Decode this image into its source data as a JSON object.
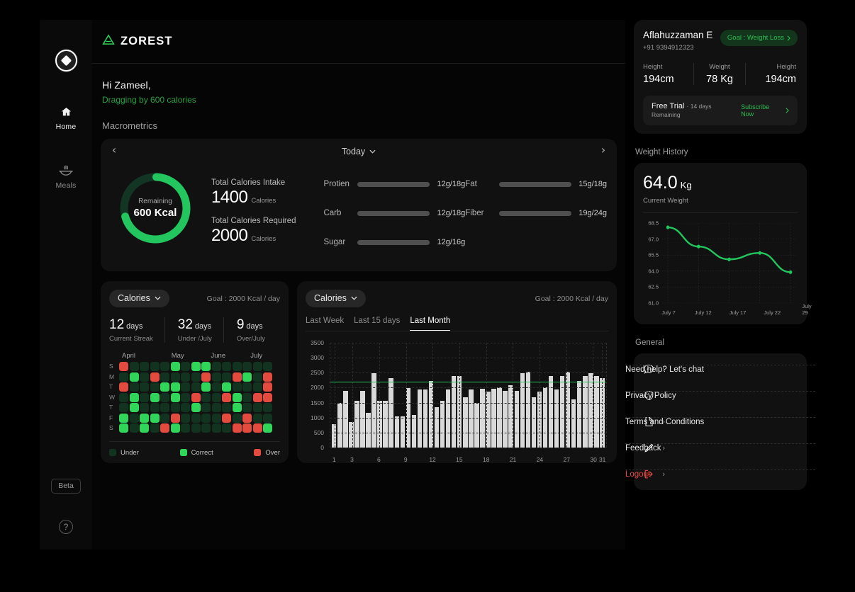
{
  "nav": {
    "brand_icon": "diamond-logo-icon",
    "items": [
      {
        "label": "Home",
        "icon": "home-icon",
        "active": true
      },
      {
        "label": "Meals",
        "icon": "meals-icon",
        "active": false
      }
    ],
    "beta_badge": "Beta",
    "help_icon": "help-circle-icon"
  },
  "header": {
    "logo_text": "ZOREST",
    "logo_icon": "zorest-triangle-icon"
  },
  "greeting": {
    "title": "Hi Zameel,",
    "subtitle": "Dragging by 600 calories"
  },
  "section_title": "Macrometrics",
  "macro": {
    "prev_icon": "chevron-left-icon",
    "next_icon": "chevron-right-icon",
    "period": "Today",
    "period_caret": "chevron-down-icon",
    "donut": {
      "center_label": "Remaining",
      "center_value": "600 Kcal",
      "percent": 70,
      "color": "#22c55e",
      "track_color": "#133524"
    },
    "intake_label": "Total Calories Intake",
    "intake_value": "1400",
    "intake_unit": "Calories",
    "required_label": "Total Calories Required",
    "required_value": "2000",
    "required_unit": "Calories",
    "nutrients_left": [
      {
        "name": "Protien",
        "value": "12g/18g",
        "percent": 66
      },
      {
        "name": "Carb",
        "value": "12g/18g",
        "percent": 66
      },
      {
        "name": "Sugar",
        "value": "12g/16g",
        "percent": 75
      }
    ],
    "nutrients_right": [
      {
        "name": "Fat",
        "value": "15g/18g",
        "percent": 68
      },
      {
        "name": "Fiber",
        "value": "19g/24g",
        "percent": 54
      }
    ]
  },
  "streak": {
    "pill_label": "Calories",
    "pill_caret": "chevron-down-icon",
    "goal": "Goal : 2000 Kcal / day",
    "stats": [
      {
        "value": "12",
        "unit": "days",
        "label": "Current Streak"
      },
      {
        "value": "32",
        "unit": "days",
        "label": "Under /July"
      },
      {
        "value": "9",
        "unit": "days",
        "label": "Over/July"
      }
    ],
    "months": [
      "April",
      "May",
      "June",
      "July"
    ],
    "day_labels": [
      "S",
      "M",
      "T",
      "W",
      "T",
      "F",
      "S"
    ],
    "colors": {
      "under": "#12331f",
      "correct": "#2fd65a",
      "over": "#e34b3f"
    },
    "grid": [
      [
        "over",
        "under",
        "under",
        "under",
        "under",
        "correct",
        "under",
        "correct",
        "correct",
        "under",
        "under",
        "under",
        "under",
        "under",
        "under"
      ],
      [
        "under",
        "correct",
        "under",
        "over",
        "under",
        "under",
        "under",
        "under",
        "over",
        "under",
        "under",
        "over",
        "correct",
        "under",
        "over"
      ],
      [
        "over",
        "under",
        "under",
        "under",
        "correct",
        "correct",
        "under",
        "under",
        "correct",
        "under",
        "correct",
        "under",
        "under",
        "under",
        "over"
      ],
      [
        "under",
        "correct",
        "under",
        "correct",
        "under",
        "correct",
        "under",
        "over",
        "under",
        "under",
        "over",
        "correct",
        "under",
        "over",
        "over"
      ],
      [
        "under",
        "correct",
        "under",
        "under",
        "under",
        "under",
        "under",
        "correct",
        "under",
        "under",
        "under",
        "correct",
        "under",
        "under",
        "under"
      ],
      [
        "correct",
        "under",
        "correct",
        "correct",
        "under",
        "over",
        "under",
        "under",
        "under",
        "under",
        "over",
        "under",
        "over",
        "under",
        "under"
      ],
      [
        "correct",
        "under",
        "correct",
        "under",
        "over",
        "correct",
        "under",
        "under",
        "under",
        "under",
        "under",
        "over",
        "over",
        "over",
        "correct"
      ]
    ],
    "legend": [
      {
        "label": "Under",
        "color": "#12331f"
      },
      {
        "label": "Correct",
        "color": "#2fd65a"
      },
      {
        "label": "Over",
        "color": "#e34b3f"
      }
    ]
  },
  "chart_card": {
    "pill_label": "Calories",
    "pill_caret": "chevron-down-icon",
    "goal": "Goal : 2000 Kcal / day",
    "tabs": [
      {
        "label": "Last Week",
        "active": false
      },
      {
        "label": "Last 15 days",
        "active": false
      },
      {
        "label": "Last Month",
        "active": true
      }
    ]
  },
  "chart_data": {
    "type": "bar",
    "title": "Calories",
    "xlabel": "",
    "ylabel": "",
    "ylim": [
      0,
      3500
    ],
    "yticks": [
      0,
      500,
      1000,
      1500,
      2000,
      2500,
      3000,
      3500
    ],
    "xticks": [
      1,
      3,
      6,
      9,
      12,
      15,
      18,
      21,
      24,
      27,
      30,
      31
    ],
    "grid": true,
    "goal_line": {
      "value": 2200,
      "color": "#22c55e",
      "label": "Goal : 2000 Kcal / day"
    },
    "bar_color": "#d9d9d9",
    "values": [
      780,
      1480,
      1890,
      860,
      1550,
      1890,
      1170,
      2480,
      1550,
      1550,
      2320,
      1040,
      1040,
      1990,
      1100,
      1950,
      1950,
      2230,
      1350,
      1550,
      1930,
      2400,
      2400,
      1680,
      1950,
      1480,
      1970,
      1870,
      1960,
      2020,
      1890,
      2080,
      1890,
      2480,
      2530,
      1680,
      1880,
      2000,
      2400,
      1930,
      2400,
      2530,
      1610,
      2230,
      2400,
      2480,
      2400,
      2320
    ]
  },
  "profile": {
    "name": "Aflahuzzaman E",
    "phone": "+91 9394912323",
    "goal_pill": "Goal : Weight Loss",
    "goal_pill_chevron": "chevron-right-icon",
    "metrics": [
      {
        "key": "Height",
        "value": "194cm"
      },
      {
        "key": "Weight",
        "value": "78 Kg"
      },
      {
        "key": "Height",
        "value": "194cm"
      }
    ],
    "trial_label": "Free Trial",
    "trial_sub": "· 14 days Remaining",
    "trial_cta": "Subscribe Now",
    "trial_cta_chevron": "chevron-right-icon"
  },
  "weight_history": {
    "section_label": "Weight History",
    "current_value": "64.0",
    "current_unit": "Kg",
    "current_label": "Current Weight"
  },
  "weight_chart": {
    "type": "line",
    "title": "Weight History",
    "ylim": [
      61.0,
      68.5
    ],
    "yticks": [
      "68.5",
      "67.0",
      "65.5",
      "64.0",
      "62.5",
      "61.0"
    ],
    "x": [
      "July 7",
      "July 12",
      "July 17",
      "July 22",
      "July 29"
    ],
    "values": [
      68.1,
      66.3,
      65.1,
      65.7,
      63.9
    ],
    "color": "#22c55e",
    "grid": true
  },
  "general": {
    "section_label": "General",
    "items": [
      {
        "label": "Need help? Let's chat",
        "icon": "chat-icon",
        "danger": false
      },
      {
        "label": "Privacy Policy",
        "icon": "shield-icon",
        "danger": false
      },
      {
        "label": "Terms and Conditions",
        "icon": "document-icon",
        "danger": false
      },
      {
        "label": "Feedback",
        "icon": "pencil-icon",
        "danger": false
      },
      {
        "label": "Logout",
        "icon": "logout-icon",
        "danger": true
      }
    ],
    "chevron": "chevron-right-icon"
  }
}
